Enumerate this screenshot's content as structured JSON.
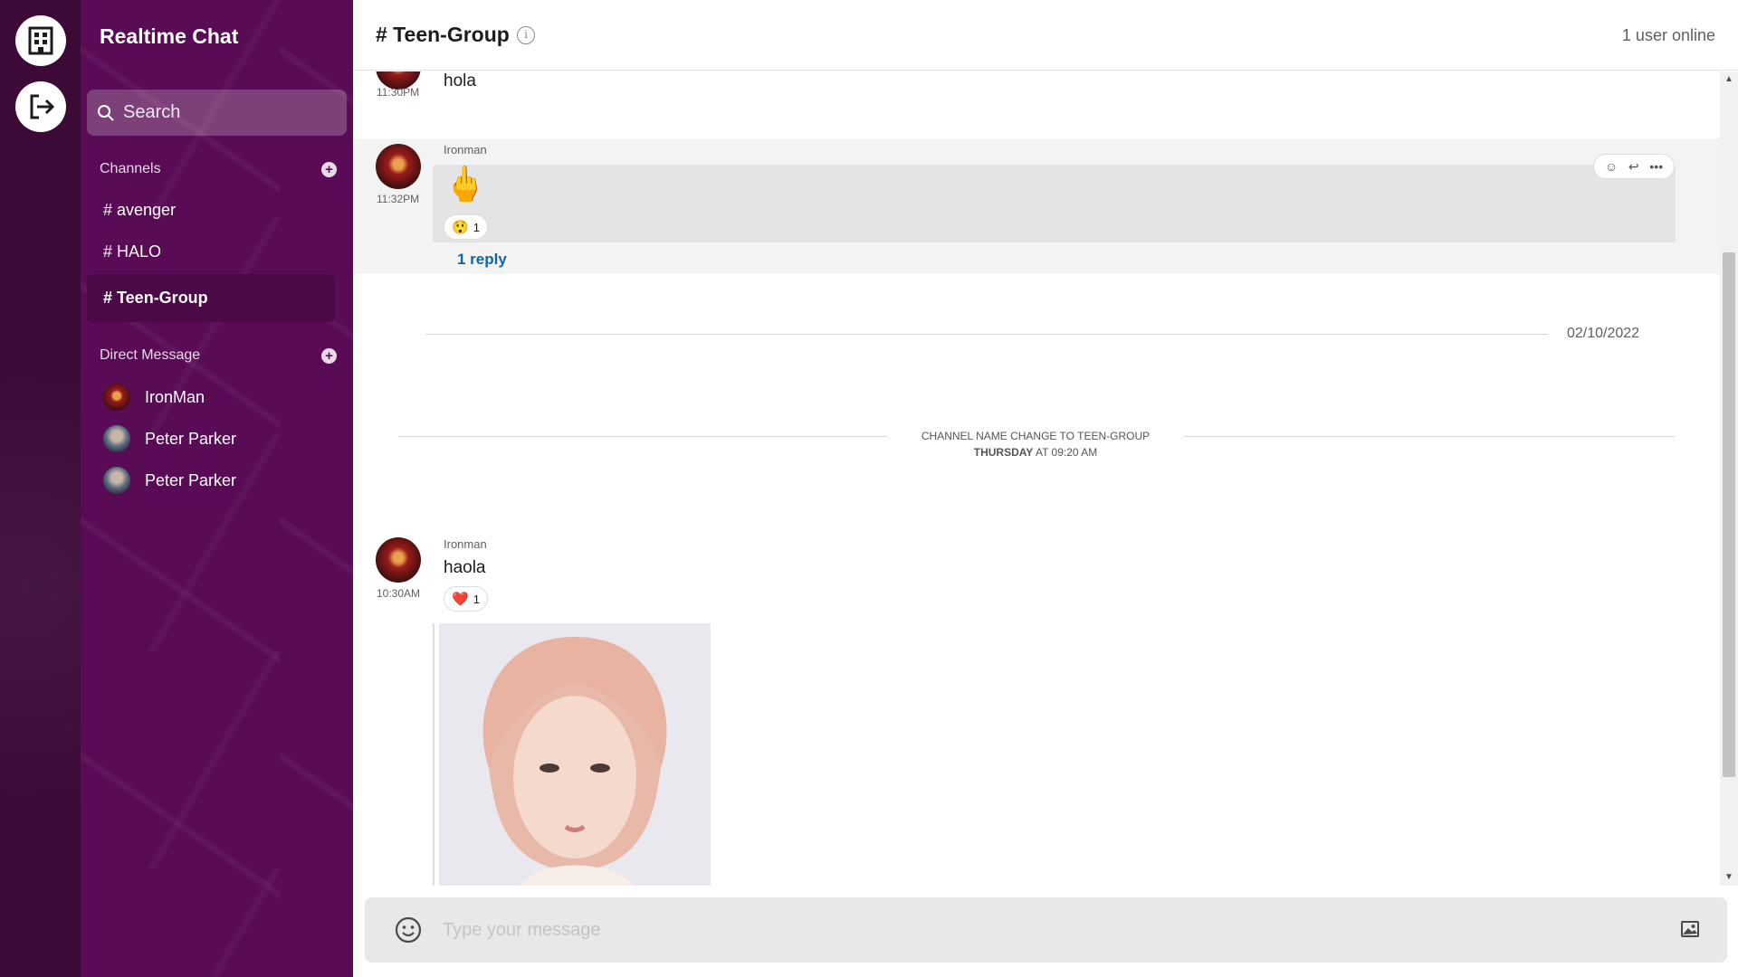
{
  "app": {
    "title": "Realtime Chat"
  },
  "search": {
    "placeholder": "Search"
  },
  "sidebar": {
    "channels_label": "Channels",
    "channels": [
      {
        "label": "# avenger",
        "active": false
      },
      {
        "label": "# HALO",
        "active": false
      },
      {
        "label": "# Teen-Group",
        "active": true
      }
    ],
    "dm_label": "Direct Message",
    "dms": [
      {
        "name": "IronMan"
      },
      {
        "name": "Peter Parker"
      },
      {
        "name": "Peter Parker"
      }
    ]
  },
  "header": {
    "channel": "# Teen-Group",
    "online": "1 user online"
  },
  "messages": [
    {
      "time": "11:30PM",
      "text": "hola"
    },
    {
      "sender": "Ironman",
      "time": "11:32PM",
      "text": "🖕",
      "reaction": {
        "emoji": "😲",
        "count": "1"
      },
      "replies": "1 reply"
    },
    {
      "sender": "Ironman",
      "time": "10:30AM",
      "text": "haola",
      "reaction": {
        "emoji": "❤️",
        "count": "1"
      }
    }
  ],
  "date_divider": "02/10/2022",
  "system_notice": {
    "line1": "CHANNEL NAME CHANGE TO TEEN-GROUP",
    "day": "THURSDAY",
    "rest": "AT 09:20 AM"
  },
  "composer": {
    "placeholder": "Type your message"
  },
  "colors": {
    "rail": "#3d0a38",
    "sidebar": "#590c55",
    "link": "#1264a3"
  }
}
